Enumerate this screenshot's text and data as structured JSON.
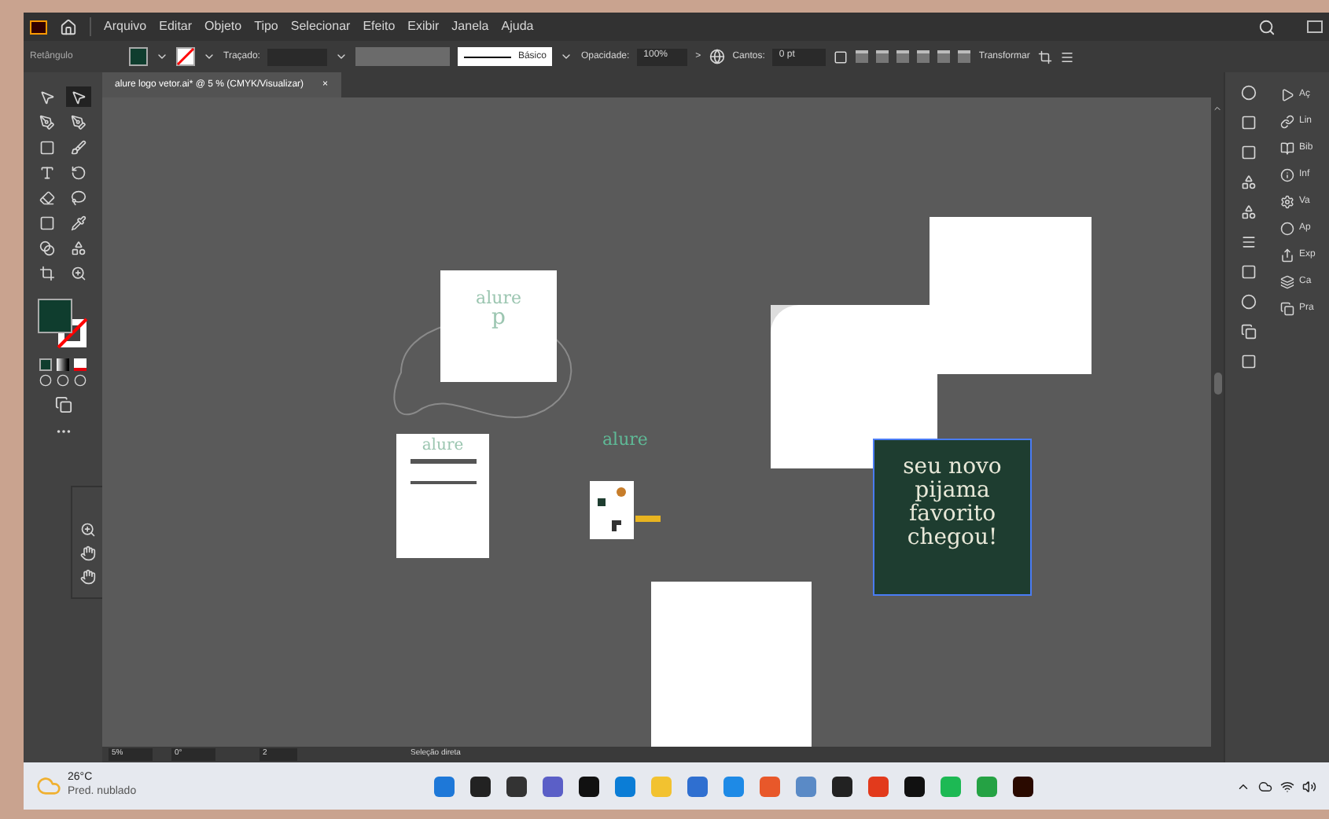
{
  "menu": [
    "Arquivo",
    "Editar",
    "Objeto",
    "Tipo",
    "Selecionar",
    "Efeito",
    "Exibir",
    "Janela",
    "Ajuda"
  ],
  "control_bar": {
    "tool_name": "Retângulo",
    "stroke_label": "Traçado:",
    "brush": "Básico",
    "opacity_label": "Opacidade:",
    "opacity": "100%",
    "more": ">",
    "corners_label": "Cantos:",
    "corners": "0 pt",
    "transform": "Transformar"
  },
  "document_tab": {
    "title": "alure logo vetor.ai* @ 5 % (CMYK/Visualizar)",
    "close": "×",
    "selected": true
  },
  "tools": [
    {
      "selected": false
    },
    {
      "selected": true
    },
    {
      "selected": false
    },
    {
      "selected": false
    },
    {
      "selected": false
    },
    {
      "selected": false
    },
    {
      "selected": false
    },
    {
      "selected": false
    },
    {
      "selected": false
    },
    {
      "selected": false
    },
    {
      "selected": false
    },
    {
      "selected": false
    },
    {
      "selected": false
    },
    {
      "selected": false
    },
    {
      "selected": false
    },
    {
      "selected": false
    }
  ],
  "canvas": {
    "logo_text": [
      "alure",
      "alure",
      "alure"
    ],
    "monogram": "p",
    "post_text": "seu novo pijama favorito chegou!"
  },
  "right_panel": [
    "Aç",
    "Lin",
    "Bib",
    "Inf",
    "Va",
    "Ap",
    "Exp",
    "Ca",
    "Pra"
  ],
  "status_bar": {
    "zoom": "5%",
    "rotation": "0°",
    "artboard": "2",
    "tool": "Seleção direta"
  },
  "taskbar": {
    "temperature": "26°C",
    "weather": "Pred. nublado"
  }
}
